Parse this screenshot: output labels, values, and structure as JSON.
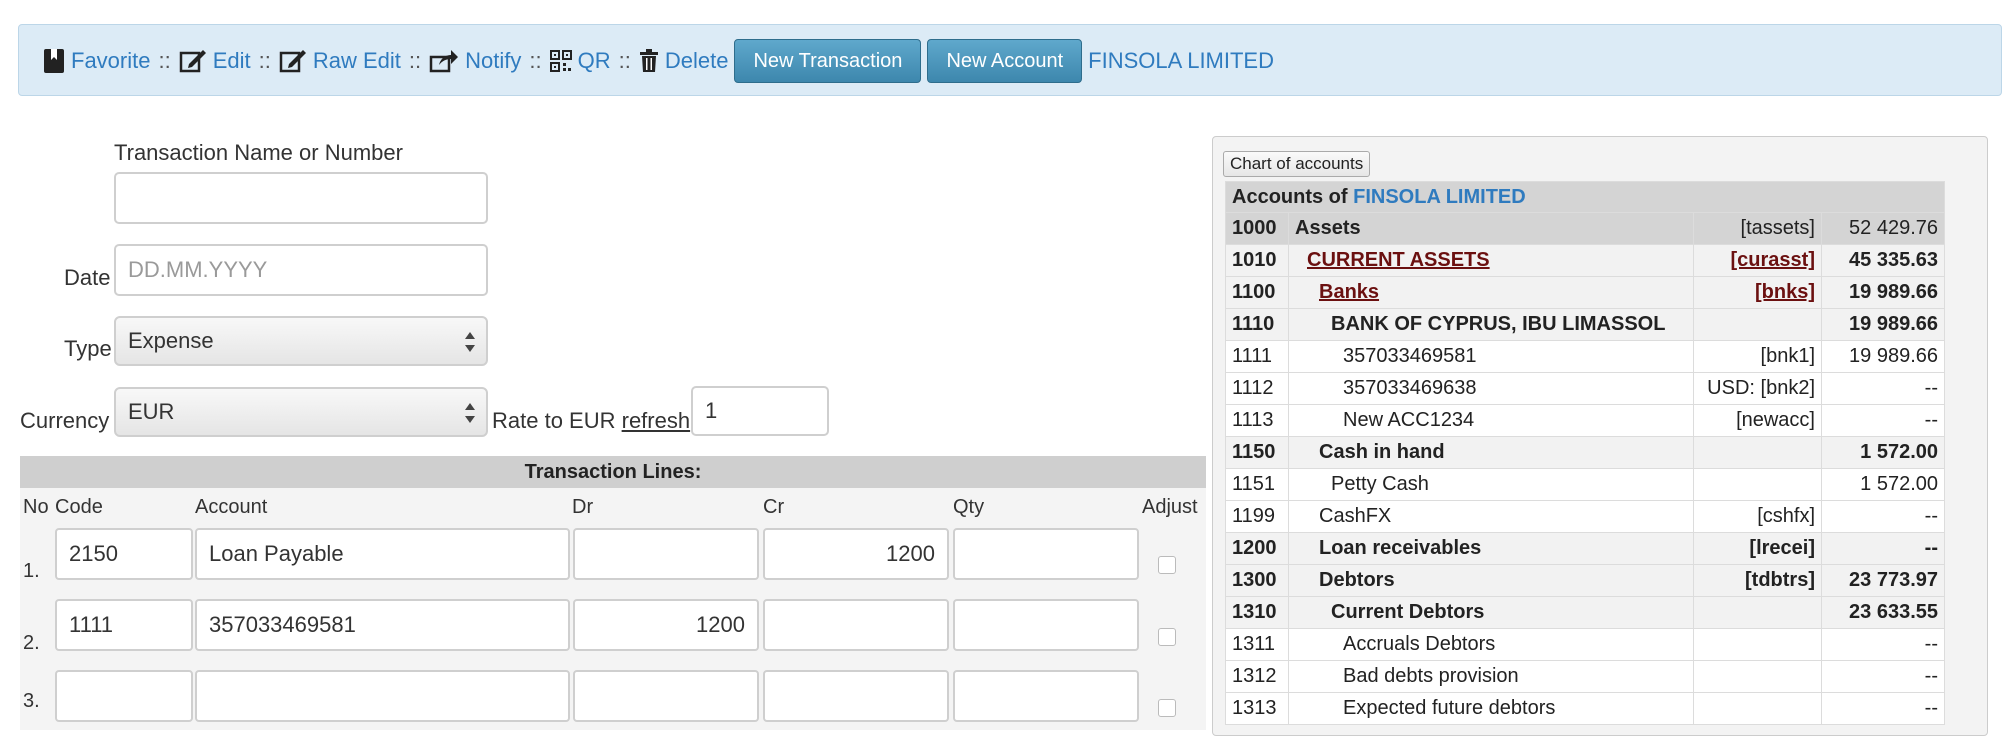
{
  "toolbar": {
    "favorite": "Favorite",
    "edit": "Edit",
    "raw_edit": "Raw Edit",
    "notify": "Notify",
    "qr": "QR",
    "delete": "Delete",
    "separator": "::",
    "new_transaction": "New Transaction",
    "new_account": "New Account",
    "company": "FINSOLA LIMITED"
  },
  "form": {
    "name_label": "Transaction Name or Number",
    "name_value": "",
    "date_label": "Date",
    "date_placeholder": "DD.MM.YYYY",
    "type_label": "Type",
    "type_value": "Expense",
    "currency_label": "Currency",
    "currency_value": "EUR",
    "rate_label": "Rate to EUR",
    "refresh_link": "refresh",
    "rate_value": "1"
  },
  "lines": {
    "title": "Transaction Lines:",
    "headers": [
      "No",
      "Code",
      "Account",
      "Dr",
      "Cr",
      "Qty",
      "Adjust"
    ],
    "rows": [
      {
        "no": "1.",
        "code": "2150",
        "account": "Loan Payable",
        "dr": "",
        "cr": "1200",
        "qty": ""
      },
      {
        "no": "2.",
        "code": "1111",
        "account": "357033469581",
        "dr": "1200",
        "cr": "",
        "qty": ""
      },
      {
        "no": "3.",
        "code": "",
        "account": "",
        "dr": "",
        "cr": "",
        "qty": ""
      }
    ]
  },
  "coa": {
    "button": "Chart of accounts",
    "heading_prefix": "Accounts of",
    "heading_company": "FINSOLA LIMITED",
    "accounts": [
      {
        "code": "1000",
        "name": "Assets",
        "tag": "[tassets]",
        "amount": "52 429.76",
        "style": "l0",
        "indent": 0
      },
      {
        "code": "1010",
        "name": "CURRENT ASSETS",
        "tag": "[curasst]",
        "amount": "45 335.63",
        "style": "maroon",
        "indent": 1
      },
      {
        "code": "1100",
        "name": "Banks",
        "tag": "[bnks]",
        "amount": "19 989.66",
        "style": "maroon",
        "indent": 2
      },
      {
        "code": "1110",
        "name": "BANK OF CYPRUS, IBU LIMASSOL",
        "tag": "",
        "amount": "19 989.66",
        "style": "bold",
        "indent": 3
      },
      {
        "code": "1111",
        "name": "357033469581",
        "tag": "[bnk1]",
        "amount": "19 989.66",
        "style": "norm",
        "indent": 4
      },
      {
        "code": "1112",
        "name": "357033469638",
        "tag": "USD: [bnk2]",
        "amount": "--",
        "style": "norm",
        "indent": 4
      },
      {
        "code": "1113",
        "name": "New ACC1234",
        "tag": "[newacc]",
        "amount": "--",
        "style": "norm",
        "indent": 4
      },
      {
        "code": "1150",
        "name": "Cash in hand",
        "tag": "",
        "amount": "1 572.00",
        "style": "bold",
        "indent": 2
      },
      {
        "code": "1151",
        "name": "Petty Cash",
        "tag": "",
        "amount": "1 572.00",
        "style": "norm",
        "indent": 3
      },
      {
        "code": "1199",
        "name": "CashFX",
        "tag": "[cshfx]",
        "amount": "--",
        "style": "norm",
        "indent": 2
      },
      {
        "code": "1200",
        "name": "Loan receivables",
        "tag": "[lrecei]",
        "amount": "--",
        "style": "bold",
        "indent": 2
      },
      {
        "code": "1300",
        "name": "Debtors",
        "tag": "[tdbtrs]",
        "amount": "23 773.97",
        "style": "bold",
        "indent": 2
      },
      {
        "code": "1310",
        "name": "Current Debtors",
        "tag": "",
        "amount": "23 633.55",
        "style": "bold",
        "indent": 3
      },
      {
        "code": "1311",
        "name": "Accruals Debtors",
        "tag": "",
        "amount": "--",
        "style": "norm",
        "indent": 4
      },
      {
        "code": "1312",
        "name": "Bad debts provision",
        "tag": "",
        "amount": "--",
        "style": "norm",
        "indent": 4
      },
      {
        "code": "1313",
        "name": "Expected future debtors",
        "tag": "",
        "amount": "--",
        "style": "norm",
        "indent": 4
      }
    ]
  },
  "colors": {
    "accent": "#2f7bbf",
    "toolbar_bg": "#dcebf6",
    "button": "#3d87ad",
    "maroon": "#6b1010"
  }
}
